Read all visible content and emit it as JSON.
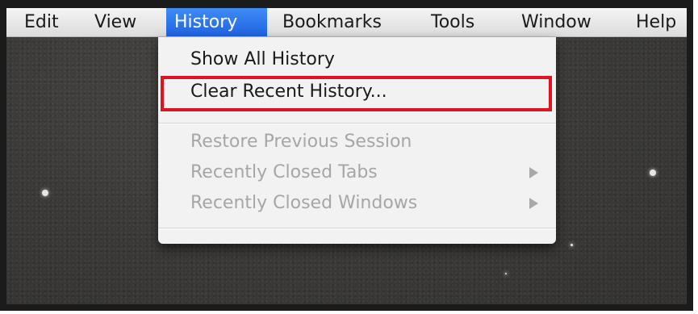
{
  "menubar": {
    "items": [
      {
        "label": "Edit",
        "active": false
      },
      {
        "label": "View",
        "active": false
      },
      {
        "label": "History",
        "active": true
      },
      {
        "label": "Bookmarks",
        "active": false
      },
      {
        "label": "Tools",
        "active": false
      },
      {
        "label": "Window",
        "active": false
      },
      {
        "label": "Help",
        "active": false
      }
    ]
  },
  "history_menu": {
    "items": [
      {
        "label": "Show All History",
        "enabled": true
      },
      {
        "label": "Clear Recent History...",
        "enabled": true,
        "highlighted": true
      },
      {
        "label": "Restore Previous Session",
        "enabled": false
      },
      {
        "label": "Recently Closed Tabs",
        "enabled": false,
        "submenu": true
      },
      {
        "label": "Recently Closed Windows",
        "enabled": false,
        "submenu": true
      }
    ]
  },
  "colors": {
    "menu_active_bg": "#2f74ec",
    "highlight_box": "#e0141e",
    "disabled_text": "#a6a6a6",
    "desktop_bg": "#3c3b39"
  }
}
